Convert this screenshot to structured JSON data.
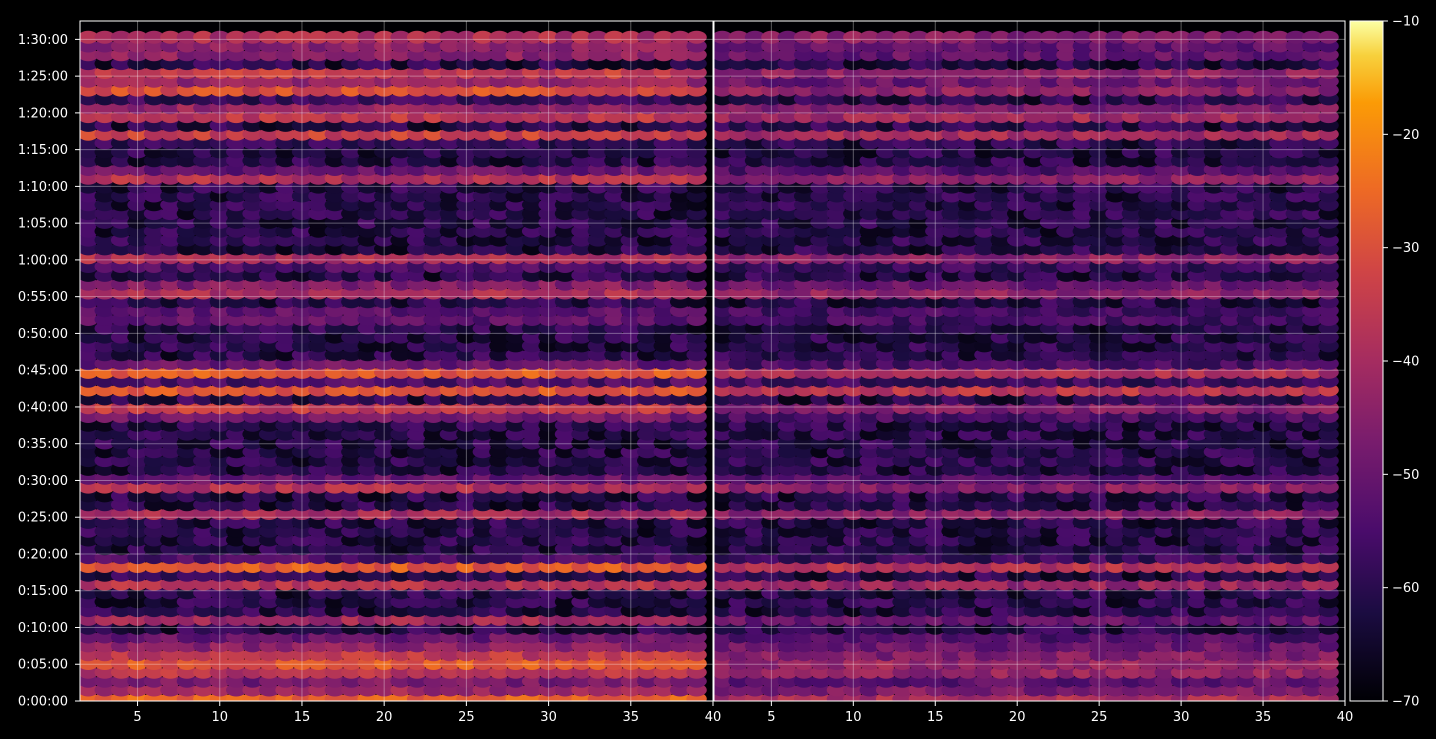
{
  "chart_data": {
    "type": "heatmap",
    "title": "",
    "xlabel": "",
    "ylabel": "",
    "grid": true,
    "panels": [
      {
        "name": "",
        "x_range": [
          1.5,
          40
        ],
        "x_ticks": [
          5,
          10,
          15,
          20,
          25,
          30,
          35,
          40
        ]
      },
      {
        "name": "",
        "x_range": [
          1.5,
          40
        ],
        "x_ticks": [
          5,
          10,
          15,
          20,
          25,
          30,
          35,
          40
        ]
      }
    ],
    "y_range_minutes": [
      0,
      92.5
    ],
    "y_tick_minutes": [
      0,
      5,
      10,
      15,
      20,
      25,
      30,
      35,
      40,
      45,
      50,
      55,
      60,
      65,
      70,
      75,
      80,
      85,
      90
    ],
    "y_tick_labels": [
      "0:00:00",
      "0:05:00",
      "0:10:00",
      "0:15:00",
      "0:20:00",
      "0:25:00",
      "0:30:00",
      "0:35:00",
      "0:40:00",
      "0:45:00",
      "0:50:00",
      "0:55:00",
      "1:00:00",
      "1:05:00",
      "1:10:00",
      "1:15:00",
      "1:20:00",
      "1:25:00",
      "1:30:00"
    ],
    "colorbar": {
      "colormap": "inferno",
      "range": [
        -70,
        -10
      ],
      "ticks": [
        -70,
        -60,
        -50,
        -40,
        -30,
        -20,
        -10
      ],
      "tick_labels": [
        "−70",
        "−60",
        "−50",
        "−40",
        "−30",
        "−20",
        "−10"
      ]
    },
    "approx_row_profile_minutes": [
      {
        "t": 0.5,
        "left": -25,
        "right": -38
      },
      {
        "t": 2.0,
        "left": -33,
        "right": -40
      },
      {
        "t": 3.5,
        "left": -31,
        "right": -38
      },
      {
        "t": 5.0,
        "left": -28,
        "right": -42
      },
      {
        "t": 6.5,
        "left": -34,
        "right": -45
      },
      {
        "t": 8.0,
        "left": -37,
        "right": -44
      },
      {
        "t": 11.0,
        "left": -40,
        "right": -50
      },
      {
        "t": 16.0,
        "left": -37,
        "right": -42
      },
      {
        "t": 18.5,
        "left": -26,
        "right": -36
      },
      {
        "t": 25.5,
        "left": -40,
        "right": -45
      },
      {
        "t": 29.5,
        "left": -33,
        "right": -40
      },
      {
        "t": 39.5,
        "left": -28,
        "right": -42
      },
      {
        "t": 42.5,
        "left": -27,
        "right": -35
      },
      {
        "t": 45.0,
        "left": -24,
        "right": -36
      },
      {
        "t": 52.5,
        "left": -44,
        "right": -50
      },
      {
        "t": 56.0,
        "left": -30,
        "right": -36
      },
      {
        "t": 60.0,
        "left": -36,
        "right": -42
      },
      {
        "t": 71.5,
        "left": -32,
        "right": -40
      },
      {
        "t": 77.0,
        "left": -33,
        "right": -40
      },
      {
        "t": 80.0,
        "left": -25,
        "right": -32
      },
      {
        "t": 83.0,
        "left": -30,
        "right": -44
      },
      {
        "t": 85.0,
        "left": -24,
        "right": -36
      },
      {
        "t": 88.5,
        "left": -33,
        "right": -42
      },
      {
        "t": 90.5,
        "left": -37,
        "right": -44
      }
    ]
  }
}
